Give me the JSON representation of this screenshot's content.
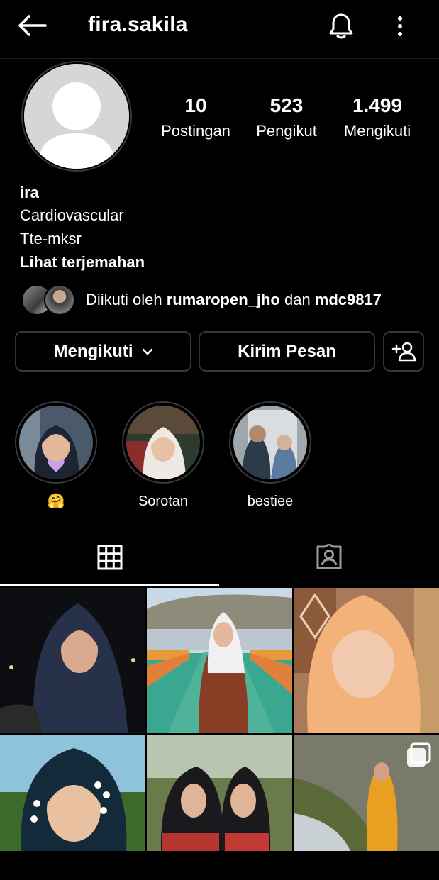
{
  "header": {
    "username": "fira.sakila",
    "back_icon": "arrow-left-icon",
    "bell_icon": "bell-icon",
    "more_icon": "more-vertical-icon"
  },
  "stats": [
    {
      "value": "10",
      "label": "Postingan"
    },
    {
      "value": "523",
      "label": "Pengikut"
    },
    {
      "value": "1.499",
      "label": "Mengikuti"
    }
  ],
  "bio": {
    "name": "ira",
    "line1": "Cardiovascular",
    "line2": "Tte-mksr",
    "translate": "Lihat terjemahan"
  },
  "followed_by": {
    "prefix": "Diikuti oleh ",
    "user1": "rumaropen_jho",
    "conj": " dan ",
    "user2": "mdc9817"
  },
  "buttons": {
    "following": "Mengikuti",
    "message": "Kirim Pesan",
    "add_user_icon": "add-person-icon"
  },
  "highlights": [
    {
      "label": "🤗"
    },
    {
      "label": "Sorotan"
    },
    {
      "label": "bestiee"
    }
  ],
  "tabs": {
    "grid_icon": "grid-icon",
    "tagged_icon": "tagged-person-icon"
  },
  "colors": {
    "background": "#000000",
    "border": "#363636",
    "text": "#ffffff"
  }
}
